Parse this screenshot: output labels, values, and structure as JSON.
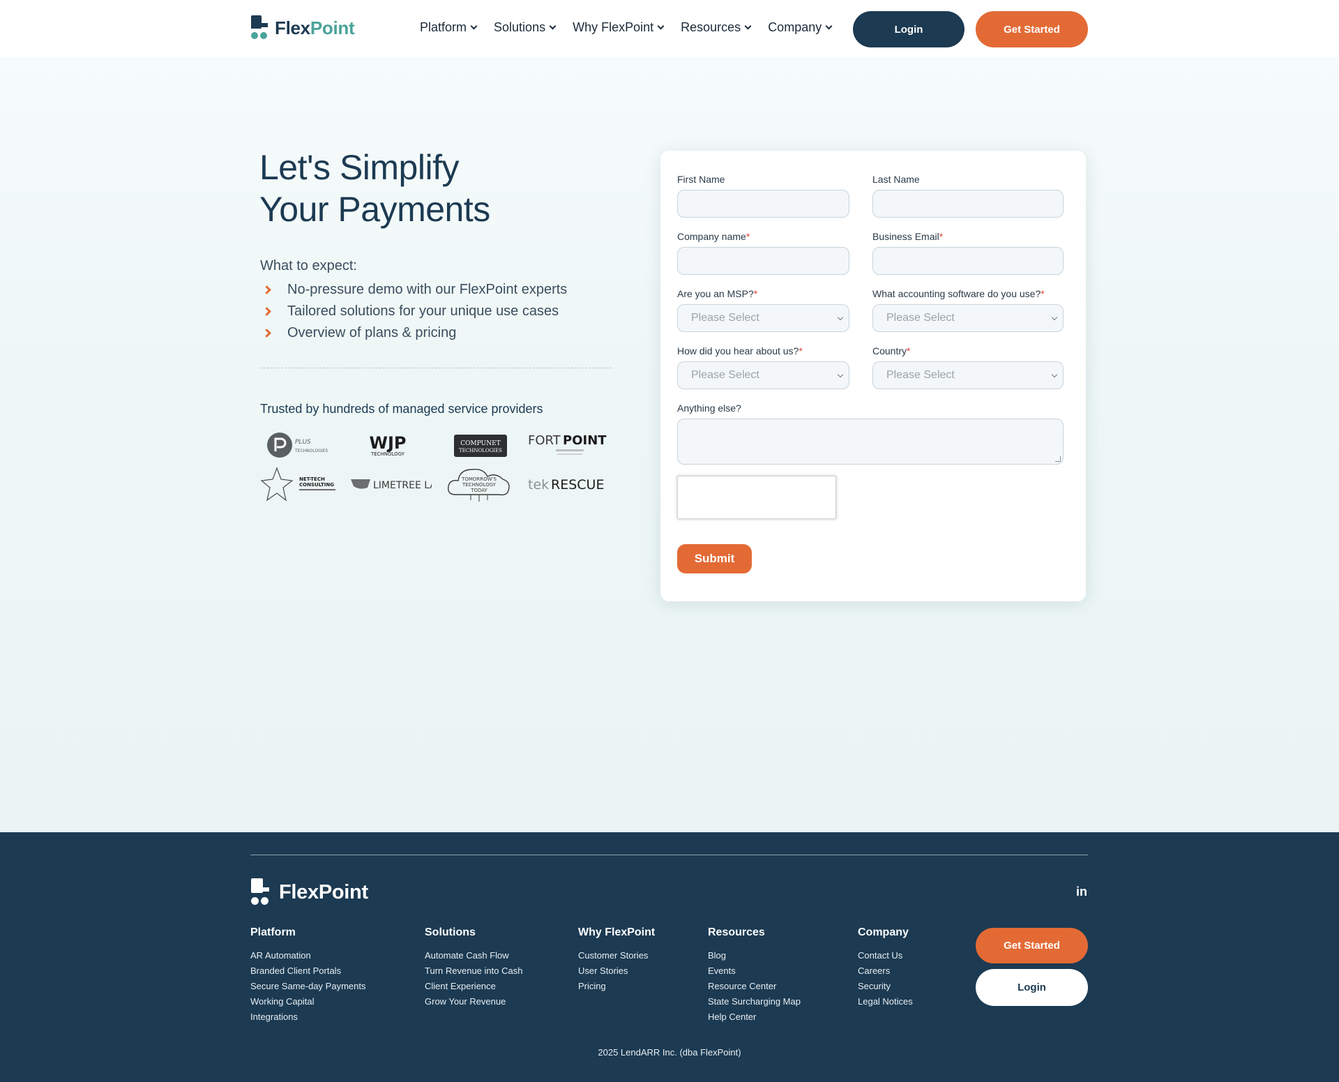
{
  "header": {
    "logo": {
      "part1": "Flex",
      "part2": "Point"
    },
    "nav": [
      {
        "label": "Platform"
      },
      {
        "label": "Solutions"
      },
      {
        "label": "Why FlexPoint"
      },
      {
        "label": "Resources"
      },
      {
        "label": "Company"
      }
    ],
    "login_label": "Login",
    "get_started_label": "Get Started"
  },
  "hero": {
    "title_line1": "Let's Simplify",
    "title_line2": "Your Payments",
    "expect_title": "What to expect:",
    "expect_items": [
      "No-pressure demo with our FlexPoint experts",
      "Tailored solutions for your unique use cases",
      "Overview of plans & pricing"
    ],
    "trusted_label": "Trusted by hundreds of managed service providers",
    "partner_logos": [
      {
        "name": "Plus Technologies",
        "text": "PLUS",
        "sub": "TECHNOLOGIES"
      },
      {
        "name": "WJP Technology",
        "text": "WJP",
        "sub": "TECHNOLOGY"
      },
      {
        "name": "Compunet Technologies",
        "text": "COMPUNET",
        "sub": "TECHNOLOGIES"
      },
      {
        "name": "FortPoint",
        "text_a": "FORT",
        "text_b": "POINT"
      },
      {
        "name": "Net-Tech Consulting",
        "text": "NET-TECH",
        "sub": "CONSULTING"
      },
      {
        "name": "Limetree Labs",
        "text": "LIMETREE LABS"
      },
      {
        "name": "Tomorrow's Technology Today",
        "text": "TOMORROW'S",
        "sub": "TECHNOLOGY",
        "sub2": "TODAY"
      },
      {
        "name": "tekRESCUE",
        "text_a": "tek",
        "text_b": "RESCUE"
      }
    ]
  },
  "form": {
    "first_name_label": "First Name",
    "last_name_label": "Last Name",
    "company_label": "Company name",
    "email_label": "Business Email",
    "msp_label": "Are you an MSP?",
    "accounting_label": "What accounting software do you use?",
    "hear_label": "How did you hear about us?",
    "country_label": "Country",
    "anything_label": "Anything else?",
    "required_mark": "*",
    "select_placeholder": "Please Select",
    "submit_label": "Submit"
  },
  "footer": {
    "logo_text": "FlexPoint",
    "linkedin_label": "in",
    "columns": [
      {
        "title": "Platform",
        "links": [
          "AR Automation",
          "Branded Client Portals",
          "Secure Same-day Payments",
          "Working Capital",
          "Integrations"
        ]
      },
      {
        "title": "Solutions",
        "links": [
          "Automate Cash Flow",
          "Turn Revenue into Cash",
          "Client Experience",
          "Grow Your Revenue"
        ]
      },
      {
        "title": "Why FlexPoint",
        "links": [
          "Customer Stories",
          "User Stories",
          "Pricing"
        ]
      },
      {
        "title": "Resources",
        "links": [
          "Blog",
          "Events",
          "Resource Center",
          "State Surcharging Map",
          "Help Center"
        ]
      },
      {
        "title": "Company",
        "links": [
          "Contact Us",
          "Careers",
          "Security",
          "Legal Notices"
        ]
      }
    ],
    "get_started_label": "Get Started",
    "login_label": "Login",
    "copyright": "2025 LendARR Inc. (dba FlexPoint)"
  },
  "colors": {
    "navy": "#1c3a52",
    "orange": "#e36a35",
    "teal": "#4aa39a",
    "required": "#e0433a"
  }
}
